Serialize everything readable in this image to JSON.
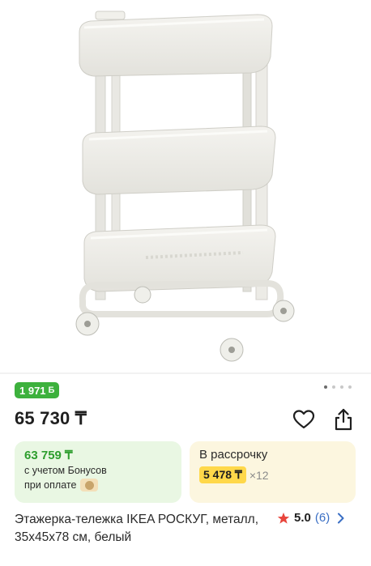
{
  "product": {
    "name": "Этажерка-тележка IKEA РОСКУГ, металл, 35x45x78 см, белый",
    "bonus_badge": "1 971",
    "bonus_symbol": "Б",
    "price": "65 730 ₸",
    "rating": {
      "score": "5.0",
      "count": "(6)"
    }
  },
  "gallery": {
    "slides_total": 4,
    "active_index": 0,
    "image_icon": "rolling-cart-photo"
  },
  "bonus_card": {
    "price": "63 759 ₸",
    "line1": "с учетом Бонусов",
    "line2": "при оплате"
  },
  "installment_card": {
    "title": "В рассрочку",
    "amount": "5 478 ₸",
    "multiplier": "×12"
  },
  "colors": {
    "bonus_green": "#3db13d",
    "bonus_card_bg": "#e9f7e3",
    "install_card_bg": "#fcf6df",
    "install_highlight": "#ffd84a",
    "star": "#e8453c",
    "link_blue": "#3a6fc4"
  }
}
